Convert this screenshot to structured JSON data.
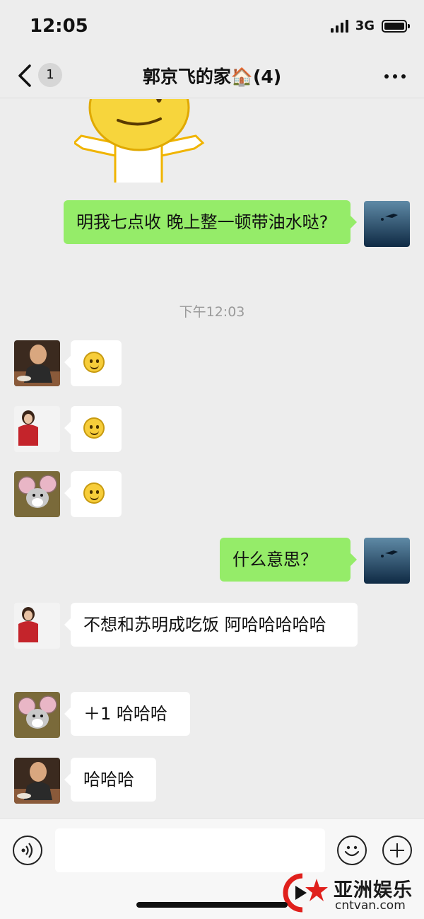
{
  "status_bar": {
    "time": "12:05",
    "network": "3G",
    "battery_level": 1.0
  },
  "nav": {
    "unread_count": "1",
    "title": "郭京飞的家🏠(4)"
  },
  "messages": [
    {
      "side": "out",
      "text": "明我七点收 晚上整一顿带油水哒?"
    },
    {
      "timestamp": "下午12:03"
    },
    {
      "side": "in",
      "sender_avatar": "man-dining-photo",
      "emoji": "smile-emoji"
    },
    {
      "side": "in",
      "sender_avatar": "woman-red-coat-photo",
      "emoji": "smile-emoji"
    },
    {
      "side": "in",
      "sender_avatar": "cartoon-mouse-avatar",
      "emoji": "smile-emoji"
    },
    {
      "side": "out",
      "text": "什么意思？"
    },
    {
      "side": "in",
      "sender_avatar": "woman-red-coat-photo",
      "text": "不想和苏明成吃饭 阿哈哈哈哈哈"
    },
    {
      "side": "in",
      "sender_avatar": "cartoon-mouse-avatar",
      "text": "＋1 哈哈哈"
    },
    {
      "side": "in",
      "sender_avatar": "man-dining-photo",
      "text": "哈哈哈"
    }
  ],
  "input_bar": {
    "placeholder": ""
  },
  "watermark": {
    "name": "亚洲娱乐",
    "domain": "cntvan.com"
  },
  "colors": {
    "background": "#ededed",
    "outgoing_bubble": "#95ec69",
    "incoming_bubble": "#ffffff"
  }
}
